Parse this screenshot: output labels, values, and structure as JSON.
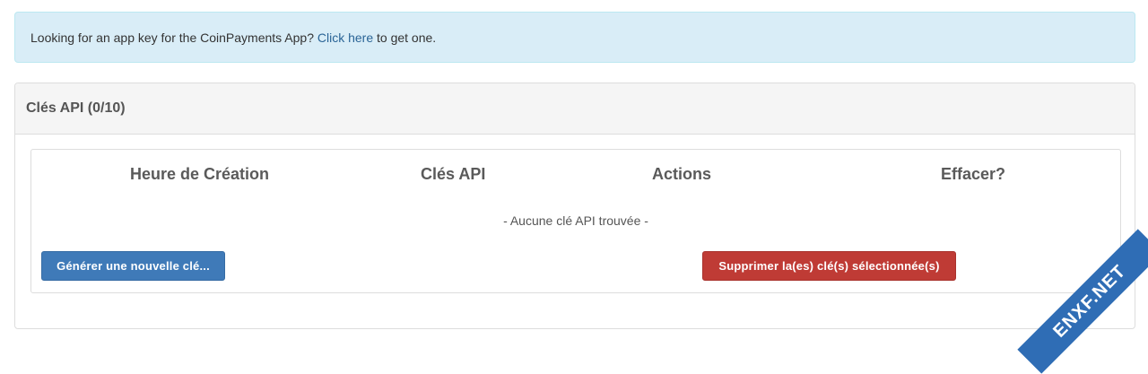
{
  "alert": {
    "prefix": "Looking for an app key for the CoinPayments App?",
    "link": "Click here",
    "suffix": "to get one."
  },
  "panel": {
    "title": "Clés API (0/10)",
    "columns": [
      "Heure de Création",
      "Clés API",
      "Actions",
      "Effacer?"
    ],
    "empty_message": "- Aucune clé API trouvée -",
    "generate_button": "Générer une nouvelle clé...",
    "delete_button": "Supprimer la(es) clé(s) sélectionnée(s)"
  },
  "watermark": "ENXF.NET",
  "colors": {
    "alert_bg": "#d9edf7",
    "primary": "#3f7ab8",
    "danger": "#bf3b35"
  }
}
